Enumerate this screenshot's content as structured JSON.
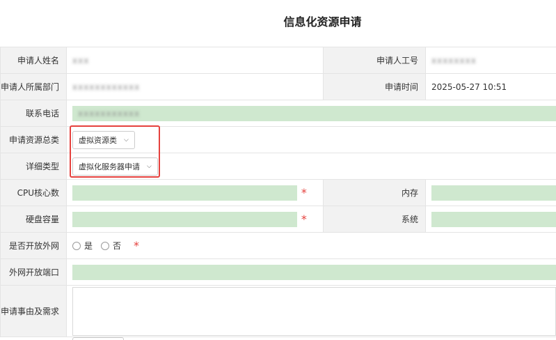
{
  "page": {
    "title": "信息化资源申请"
  },
  "form": {
    "applicant_name": {
      "label": "申请人姓名",
      "value": "xxx"
    },
    "employee_id": {
      "label": "申请人工号",
      "value": "xxxxxxxx"
    },
    "department": {
      "label": "申请人所属部门",
      "value": "xxxxxxxxxxxx"
    },
    "apply_time": {
      "label": "申请时间",
      "value": "2025-05-27 10:51"
    },
    "phone": {
      "label": "联系电话",
      "value": "xxxxxxxxxxx"
    },
    "resource_category": {
      "label": "申请资源总类",
      "selected": "虚拟资源类"
    },
    "detail_type": {
      "label": "详细类型",
      "selected": "虚拟化服务器申请"
    },
    "cpu_cores": {
      "label": "CPU核心数",
      "value": "",
      "required_mark": "*"
    },
    "memory": {
      "label": "内存",
      "value": ""
    },
    "disk_capacity": {
      "label": "硬盘容量",
      "value": "",
      "required_mark": "*"
    },
    "system": {
      "label": "系统",
      "value": ""
    },
    "open_external_network": {
      "label": "是否开放外网",
      "options": [
        "是",
        "否"
      ],
      "required_mark": "*"
    },
    "external_port": {
      "label": "外网开放端口",
      "value": ""
    },
    "reason": {
      "label": "申请事由及需求",
      "value": ""
    }
  },
  "colors": {
    "input_background": "#cfe8cf",
    "label_background": "#f2f2f2",
    "required": "#e5413d",
    "highlight_border": "#e5413d"
  },
  "icons": {
    "select_arrow": "chevron-down-icon"
  }
}
